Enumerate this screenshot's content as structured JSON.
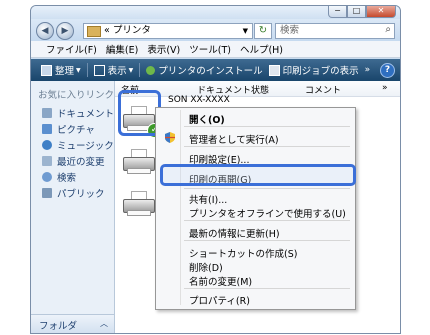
{
  "window": {
    "address": "« プリンタ",
    "search_placeholder": "検索",
    "caption_buttons": [
      "−",
      "□",
      "✕"
    ]
  },
  "menubar": [
    "ファイル(F)",
    "編集(E)",
    "表示(V)",
    "ツール(T)",
    "ヘルプ(H)"
  ],
  "toolbar": {
    "organize": "整理",
    "view": "表示",
    "install_printer": "プリンタのインストール",
    "print_jobs": "印刷ジョブの表示",
    "more": "»",
    "help": "?"
  },
  "navpane": {
    "favorites_heading": "お気に入りリンク",
    "items": [
      "ドキュメント",
      "ピクチャ",
      "ミュージック",
      "最近の変更",
      "検索",
      "パブリック"
    ],
    "folders": "フォルダ"
  },
  "columns": [
    "名前",
    "ドキュメント",
    "状態",
    "コメント",
    "»"
  ],
  "printer_name": "SON XX-XXXX",
  "context_menu": {
    "open": "開く(O)",
    "run_as_admin": "管理者として実行(A)",
    "print_settings": "印刷設定(E)...",
    "resume_printing": "印刷の再開(G)",
    "sharing": "共有(I)...",
    "use_offline": "プリンタをオフラインで使用する(U)",
    "refresh": "最新の情報に更新(H)",
    "create_shortcut": "ショートカットの作成(S)",
    "delete": "削除(D)",
    "rename": "名前の変更(M)",
    "properties": "プロパティ(R)"
  },
  "colors": {
    "highlight": "#3b6fd8",
    "toolbar": "#1f4a70",
    "nav_link": "#1e3f6e"
  }
}
